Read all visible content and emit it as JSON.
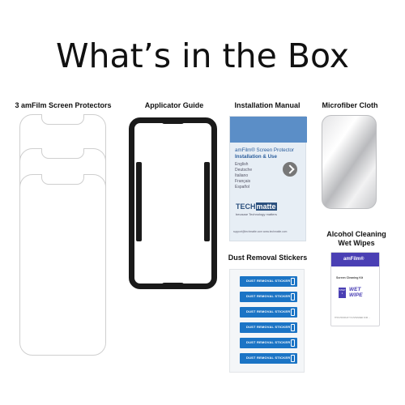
{
  "title": "What’s in the Box",
  "items": {
    "protectors": {
      "label": "3 amFilm Screen Protectors"
    },
    "applicator": {
      "label": "Applicator Guide"
    },
    "manual": {
      "label": "Installation Manual",
      "heading_brand": "amFilm® Screen Protector",
      "heading_sub": "Installation & Use",
      "languages": [
        "English",
        "Deutsche",
        "Italiano",
        "Français",
        "Español"
      ],
      "brand_a": "TECH",
      "brand_b": "matte",
      "tagline": "because Technology matters",
      "footer": "support@techmatte.com     www.techmatte.com"
    },
    "cloth": {
      "label": "Microfiber Cloth"
    },
    "dust": {
      "label": "Dust Removal Stickers",
      "sticker_text": "DUST REMOVAL STICKER"
    },
    "wipes": {
      "label_line1": "Alcohol Cleaning",
      "label_line2": "Wet Wipes",
      "logo": "amFilm®",
      "kit": "Screen Cleaning Kit",
      "step": "STEP 1",
      "wet1": "WET",
      "wet2": "WIPE",
      "fine": "THIS PRODUCT IS INTENDED FOR ..."
    }
  },
  "colors": {
    "accent_blue": "#1b74c5",
    "manual_blue": "#5b8ec7",
    "wipe_purple": "#4a3fb4",
    "ink": "#1a1a1a"
  }
}
